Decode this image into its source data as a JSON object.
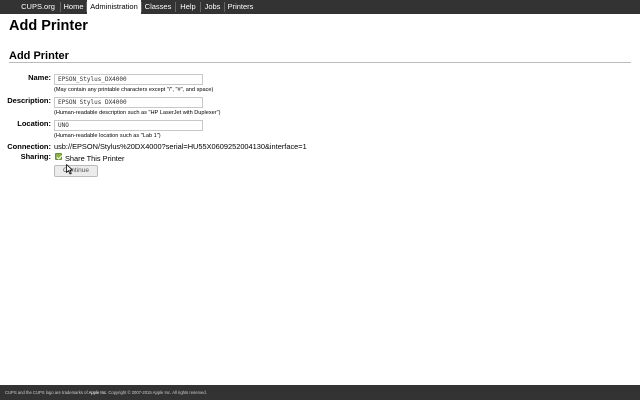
{
  "nav": {
    "items": [
      {
        "label": "CUPS.org"
      },
      {
        "label": "Home"
      },
      {
        "label": "Administration",
        "active": true
      },
      {
        "label": "Classes"
      },
      {
        "label": "Help"
      },
      {
        "label": "Jobs"
      },
      {
        "label": "Printers"
      }
    ]
  },
  "page": {
    "title": "Add Printer",
    "section_title": "Add Printer"
  },
  "form": {
    "name": {
      "label": "Name:",
      "value": "EPSON_Stylus_DX4000",
      "help": "(May contain any printable characters except \"/\", \"#\", and space)"
    },
    "description": {
      "label": "Description:",
      "value": "EPSON Stylus DX4000",
      "help": "(Human-readable description such as \"HP LaserJet with Duplexer\")"
    },
    "location": {
      "label": "Location:",
      "value": "UNO",
      "help": "(Human-readable location such as \"Lab 1\")"
    },
    "connection": {
      "label": "Connection:",
      "value": "usb://EPSON/Stylus%20DX4000?serial=HU55X0609252004130&interface=1"
    },
    "sharing": {
      "label": "Sharing:",
      "checkbox_label": "Share This Printer",
      "checked": true
    },
    "continue_label": "Continue"
  },
  "footer": {
    "text_prefix": "CUPS and the CUPS logo are trademarks of ",
    "company": "Apple Inc",
    "text_suffix": ". Copyright © 2007-2015 Apple Inc. All rights reserved."
  },
  "colors": {
    "nav_bg": "#333333",
    "checkbox_green": "#8cb34a"
  },
  "icons": {
    "checkbox": "check-icon",
    "cursor": "arrow-cursor-icon"
  }
}
